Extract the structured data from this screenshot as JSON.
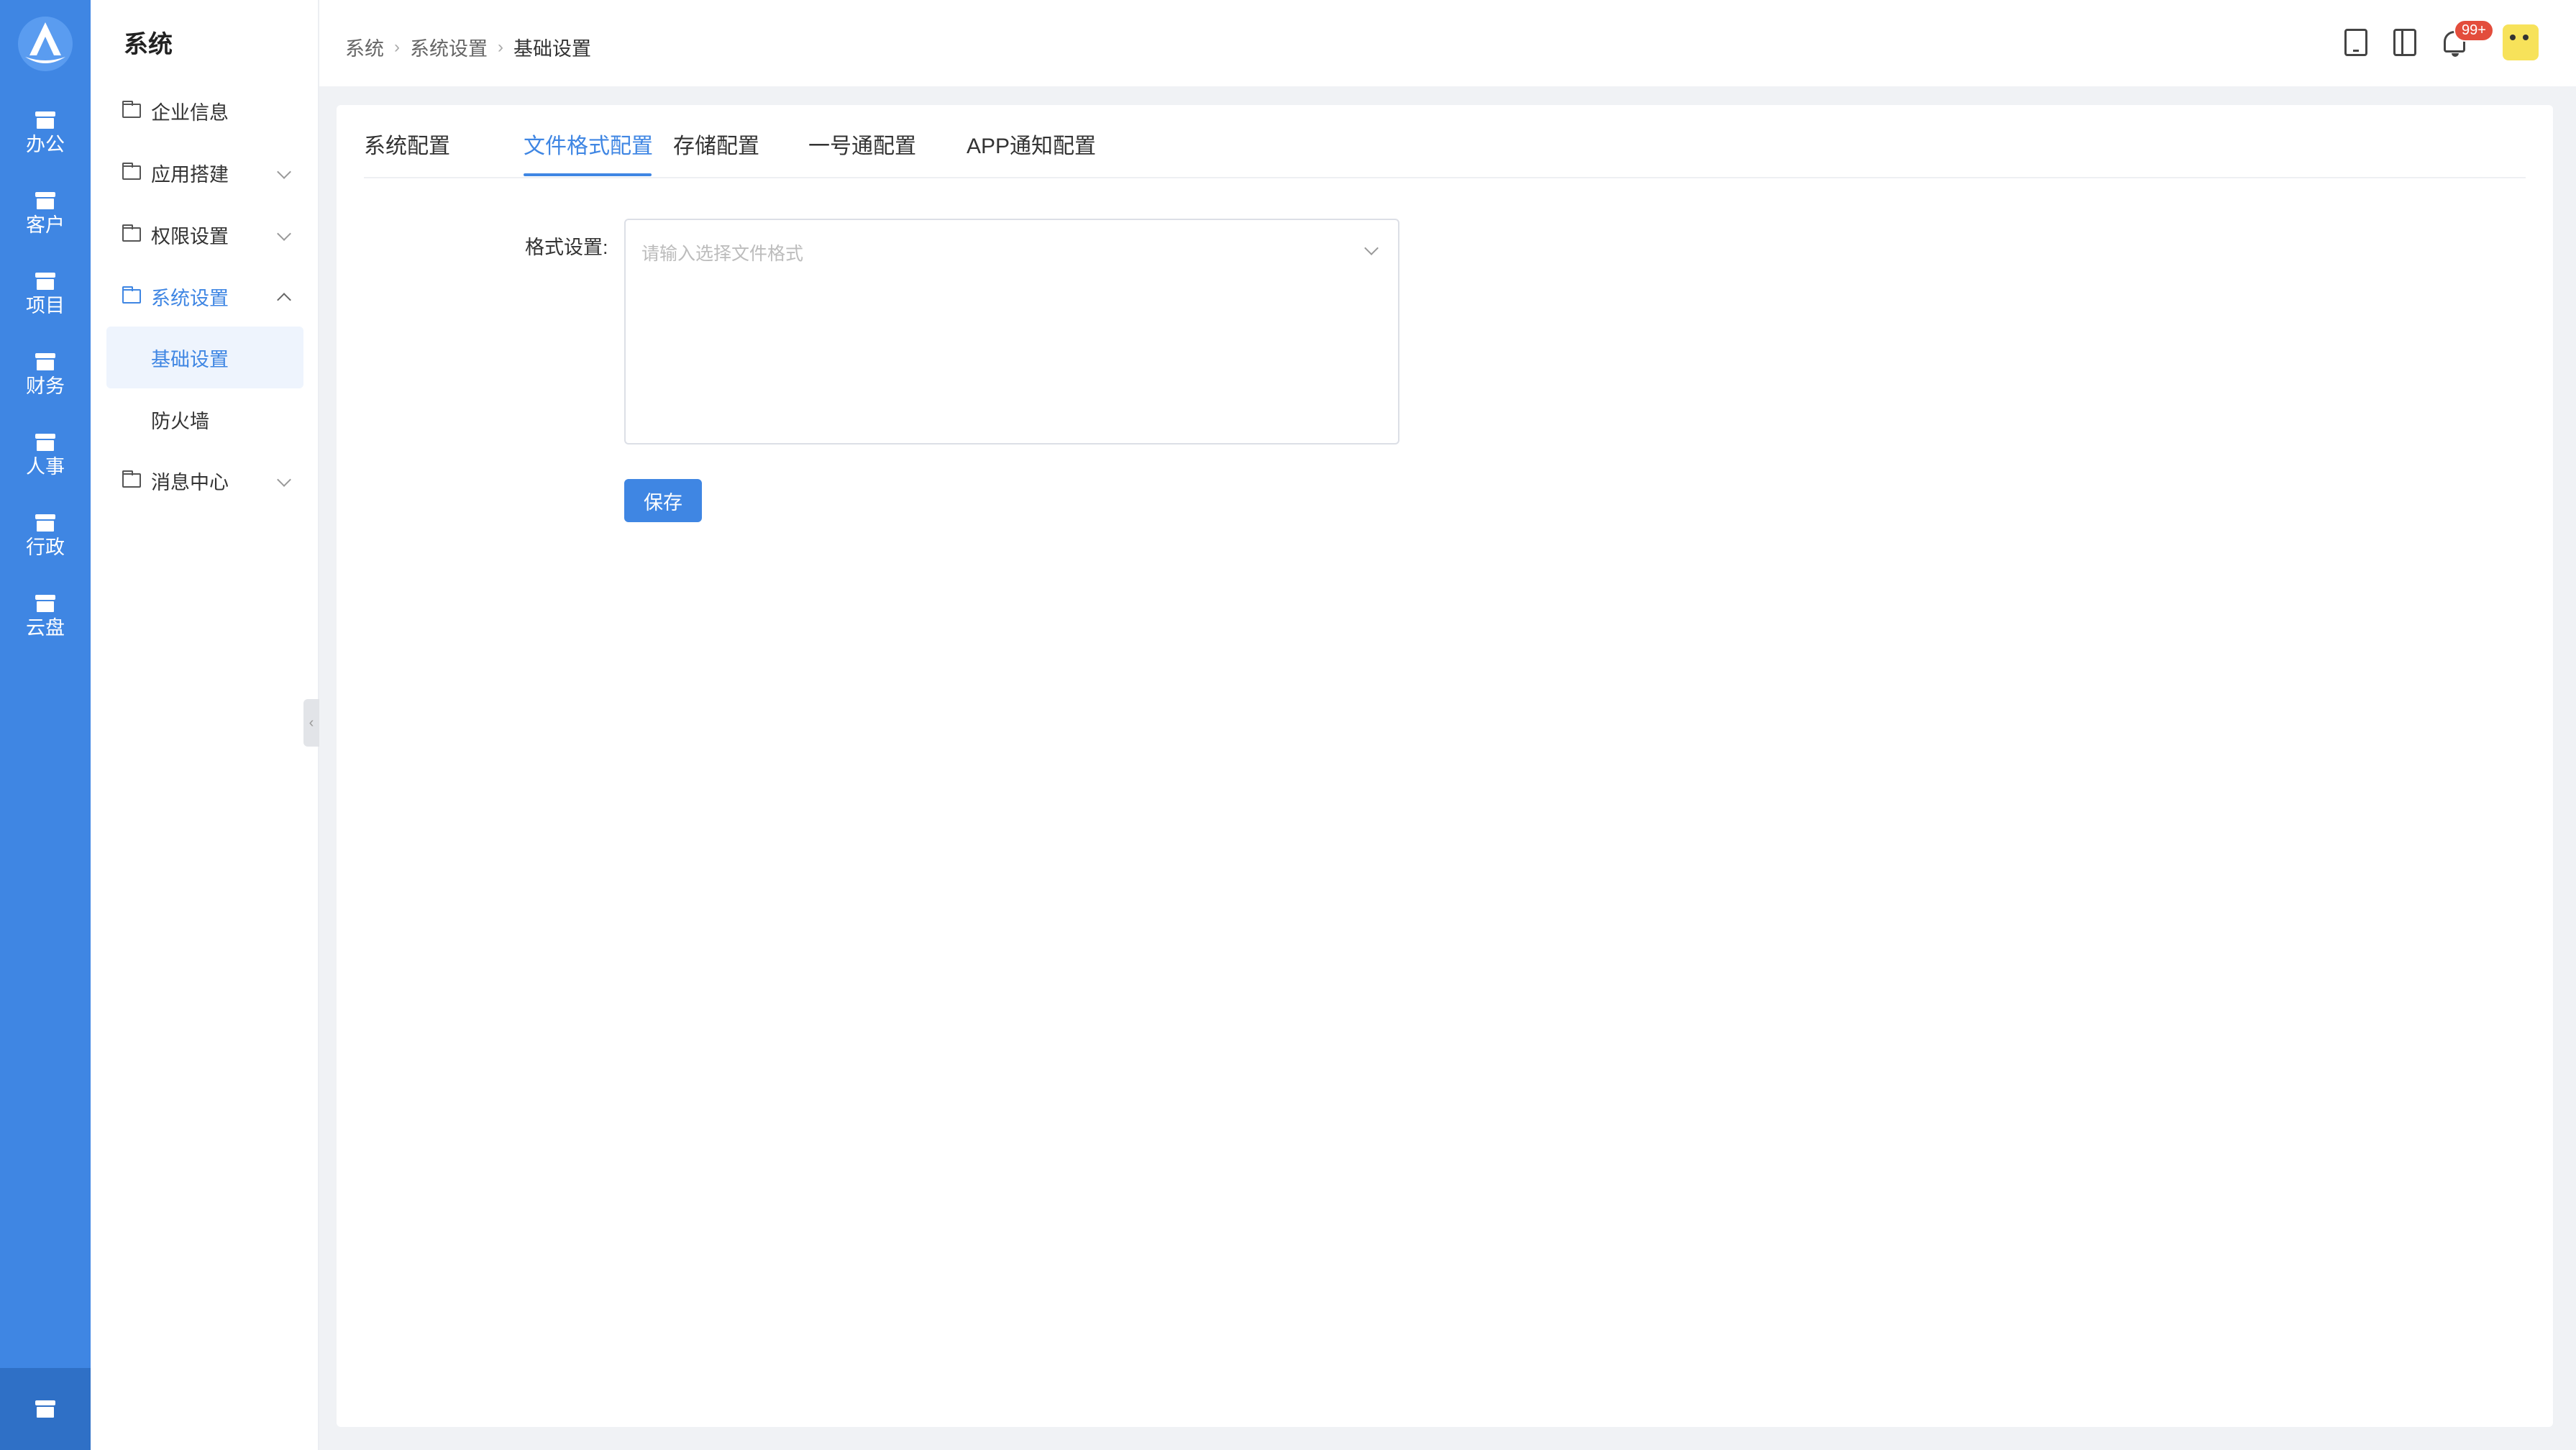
{
  "rail": {
    "items": [
      {
        "label": "办公"
      },
      {
        "label": "客户"
      },
      {
        "label": "项目"
      },
      {
        "label": "财务"
      },
      {
        "label": "人事"
      },
      {
        "label": "行政"
      },
      {
        "label": "云盘"
      }
    ]
  },
  "sidebar": {
    "title": "系统",
    "items": [
      {
        "label": "企业信息"
      },
      {
        "label": "应用搭建"
      },
      {
        "label": "权限设置"
      },
      {
        "label": "系统设置"
      },
      {
        "label": "消息中心"
      }
    ],
    "sub_items": [
      {
        "label": "基础设置"
      },
      {
        "label": "防火墙"
      }
    ]
  },
  "breadcrumb": [
    "系统",
    "系统设置",
    "基础设置"
  ],
  "header": {
    "notification_count": "99+"
  },
  "tabs": [
    {
      "label": "系统配置"
    },
    {
      "label": "文件格式配置"
    },
    {
      "label": "存储配置"
    },
    {
      "label": "一号通配置"
    },
    {
      "label": "APP通知配置"
    }
  ],
  "active_tab": "文件格式配置",
  "form": {
    "label": "格式设置:",
    "placeholder": "请输入选择文件格式",
    "value": "",
    "save_label": "保存"
  },
  "colors": {
    "primary": "#3f86e3",
    "badge": "#e34d3c"
  }
}
